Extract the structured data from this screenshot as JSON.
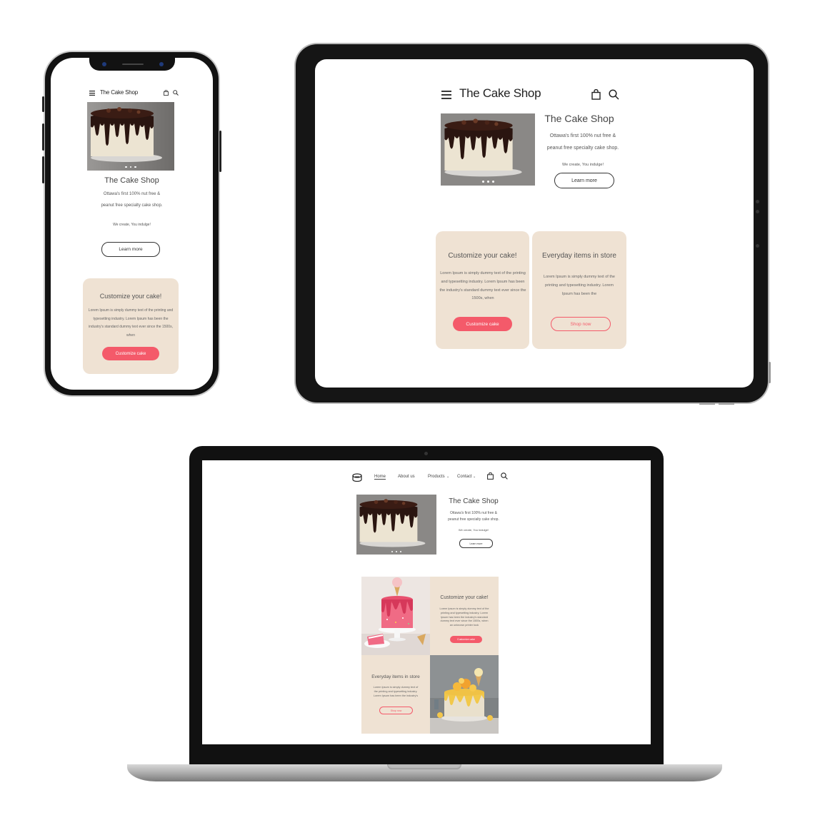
{
  "colors": {
    "accent": "#f45a6a",
    "card_bg": "#efe2d3",
    "text_dark": "#333333",
    "frame_black": "#121212"
  },
  "brand": {
    "name": "The Cake Shop",
    "logo_icon": "cake-icon"
  },
  "hero": {
    "title": "The Cake Shop",
    "tagline_line1": "Ottawa's first 100% nut free &",
    "tagline_line2": "peanut free specialty cake shop.",
    "motto": "We create, You indulge!",
    "cta_label": "Learn more"
  },
  "customize_card": {
    "title": "Customize your cake!",
    "body": "Lorem Ipsum is simply dummy text of the printing and typesetting industry. Lorem Ipsum has been the industry's standard dummy text ever since the 1500s, when",
    "body_laptop": "Lorem Ipsum is simply dummy text of the printing and typesetting industry. Lorem Ipsum has been the industry's standard dummy text ever since the 1500s, when an unknown printer took",
    "button_label": "Customize cake"
  },
  "store_card": {
    "title": "Everyday items in store",
    "body": "Lorem Ipsum is simply dummy text of the printing and typesetting industry. Lorem Ipsum has been the",
    "body_laptop": "Lorem Ipsum is simply dummy text of the printing and typesetting industry. Lorem Ipsum has been the industry's",
    "button_label": "Shop now"
  },
  "nav": {
    "items": [
      {
        "label": "Home",
        "active": true
      },
      {
        "label": "About us",
        "active": false
      },
      {
        "label": "Products",
        "active": false,
        "dropdown": true
      },
      {
        "label": "Contact",
        "active": false,
        "dropdown": true
      }
    ]
  },
  "icons": {
    "menu": "hamburger-menu-icon",
    "bag": "shopping-bag-icon",
    "search": "search-icon",
    "chevron": "chevron-down-icon"
  }
}
